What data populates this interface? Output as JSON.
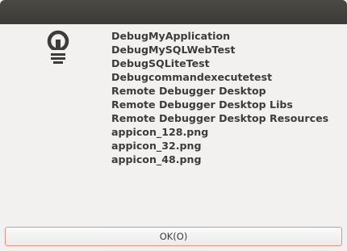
{
  "dialog": {
    "icon": "lightbulb-icon",
    "items": [
      "DebugMyApplication",
      "DebugMySQLWebTest",
      "DebugSQLiteTest",
      "Debugcommandexecutetest",
      "Remote Debugger Desktop",
      "Remote Debugger Desktop Libs",
      "Remote Debugger Desktop Resources",
      "appicon_128.png",
      "appicon_32.png",
      "appicon_48.png"
    ],
    "ok_label": "OK(O)"
  },
  "colors": {
    "titlebar": "#3c3b37",
    "background": "#f2f1f0",
    "button_border": "#e0947c",
    "text": "#3c3c3c"
  }
}
